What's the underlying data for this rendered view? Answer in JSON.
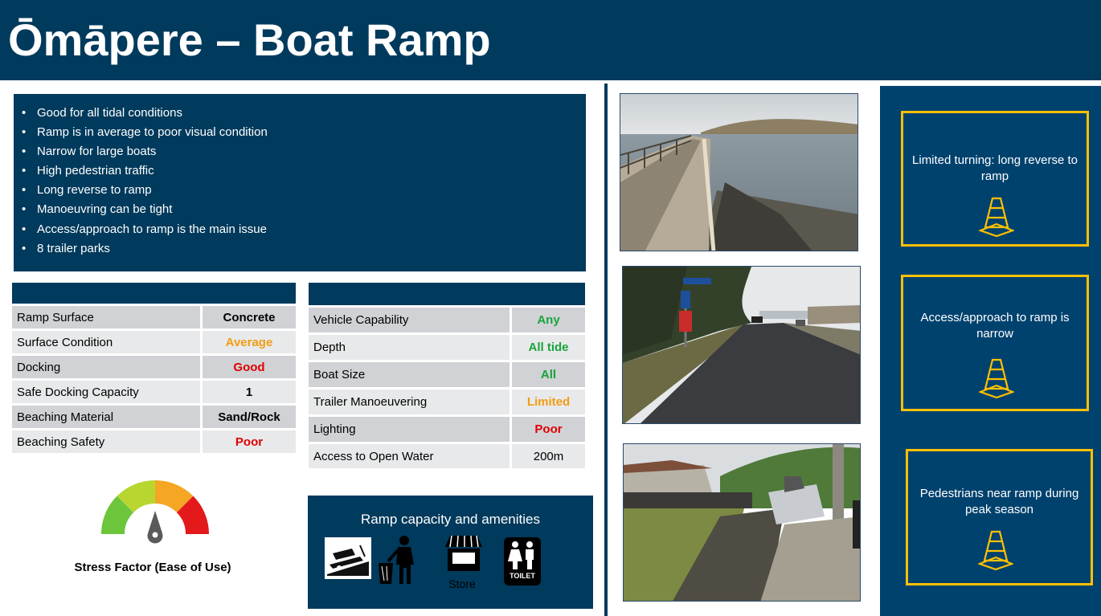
{
  "header": {
    "title": "Ōmāpere – Boat Ramp"
  },
  "notes": [
    "Good for all tidal conditions",
    "Ramp is in average to poor visual condition",
    "Narrow for large boats",
    "High pedestrian traffic",
    "Long reverse to ramp",
    "Manoeuvring can be tight",
    "Access/approach to ramp is the main issue",
    "8 trailer parks"
  ],
  "ramp_table": {
    "rows": [
      {
        "label": "Ramp Surface",
        "value": "Concrete",
        "color": "#000000"
      },
      {
        "label": "Surface Condition",
        "value": "Average",
        "color": "#f39c12"
      },
      {
        "label": "Docking",
        "value": "Good",
        "color": "#e00000"
      },
      {
        "label": "Safe Docking Capacity",
        "value": "1",
        "color": "#000000"
      },
      {
        "label": "Beaching Material",
        "value": "Sand/Rock",
        "color": "#000000"
      },
      {
        "label": "Beaching Safety",
        "value": "Poor",
        "color": "#e00000"
      }
    ]
  },
  "access_table": {
    "rows": [
      {
        "label": "Vehicle Capability",
        "value": "Any",
        "color": "#1aa33c"
      },
      {
        "label": "Depth",
        "value": "All tide",
        "color": "#1aa33c"
      },
      {
        "label": "Boat Size",
        "value": "All",
        "color": "#1aa33c"
      },
      {
        "label": "Trailer Manoeuvering",
        "value": "Limited",
        "color": "#f39c12"
      },
      {
        "label": "Lighting",
        "value": "Poor",
        "color": "#e00000"
      },
      {
        "label": "Access to Open Water",
        "value": "200m",
        "color": "#000000"
      }
    ]
  },
  "stress": {
    "label": "Stress Factor (Ease of Use)",
    "level": "medium",
    "segment_colors": [
      "#6cc53a",
      "#b7d630",
      "#f5a623",
      "#e3191c"
    ]
  },
  "amenities": {
    "title": "Ramp capacity and amenities",
    "icons": [
      "boat-ramp-icon",
      "rubbish-bin-icon",
      "store-icon",
      "toilet-icon"
    ],
    "store_label": "Store",
    "toilet_label": "TOILET"
  },
  "warnings": [
    {
      "text": "Limited turning: long reverse to ramp",
      "icon": "traffic-cone-icon"
    },
    {
      "text": "Access/approach to ramp is narrow",
      "icon": "traffic-cone-icon"
    },
    {
      "text": "Pedestrians near ramp during peak season",
      "icon": "traffic-cone-icon"
    }
  ],
  "colors": {
    "navy": "#003a5c",
    "panel_blue": "#00426e",
    "warning_border": "#ffc000"
  }
}
